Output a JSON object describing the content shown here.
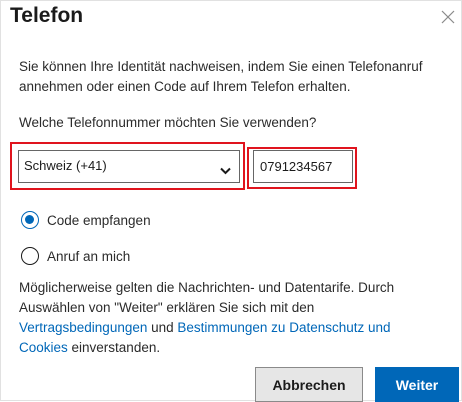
{
  "dialog": {
    "title": "Telefon",
    "close_icon": "close-icon"
  },
  "intro": {
    "line1": "Sie können Ihre Identität nachweisen, indem Sie einen Telefonanruf",
    "line2": "annehmen oder einen Code auf Ihrem Telefon erhalten."
  },
  "question": "Welche Telefonnummer möchten Sie verwenden?",
  "country_select": {
    "selected": "Schweiz (+41)"
  },
  "phone_input": {
    "value": "0791234567"
  },
  "options": [
    {
      "label": "Code empfangen",
      "checked": true
    },
    {
      "label": "Anruf an mich",
      "checked": false
    }
  ],
  "notice": {
    "line1": "Möglicherweise gelten die Nachrichten- und Datentarife. Durch",
    "line2": "Auswählen von \"Weiter\" erklären Sie sich mit den",
    "link_terms": "Vertragsbedingungen",
    "and": " und ",
    "link_privacy": "Bestimmungen zu Datenschutz und",
    "link_privacy_2": "Cookies",
    "link_privacy_3": " einverstanden.",
    "end": ""
  },
  "buttons": {
    "cancel": "Abbrechen",
    "next": "Weiter"
  },
  "colors": {
    "accent": "#0067b8",
    "highlight": "#e0141e"
  }
}
